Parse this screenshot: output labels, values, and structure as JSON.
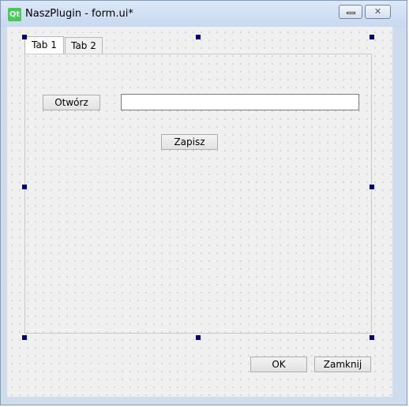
{
  "window": {
    "title": "NaszPlugin - form.ui*",
    "logo_text": "Qt",
    "minimize_glyph": "",
    "close_glyph": "✕"
  },
  "tabs": [
    {
      "label": "Tab 1",
      "active": true
    },
    {
      "label": "Tab 2",
      "active": false
    }
  ],
  "tab1": {
    "open_button_label": "Otwórz",
    "path_input_value": "",
    "save_button_label": "Zapisz"
  },
  "dialog_buttons": {
    "ok_label": "OK",
    "close_label": "Zamknij"
  },
  "colors": {
    "qt_green": "#41cd52",
    "selection_handle": "#000080",
    "titlebar": "#cfdcec",
    "form_background": "#f0f0f0"
  }
}
